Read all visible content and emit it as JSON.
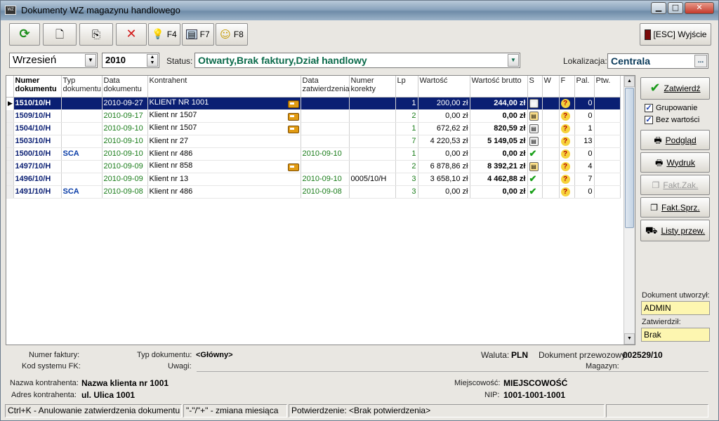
{
  "window": {
    "title": "Dokumenty WZ magazynu handlowego",
    "icon_label": "WZ"
  },
  "toolbar": {
    "f4_label": "F4",
    "f7_label": "F7",
    "f8_label": "F8",
    "exit_label": "[ESC] Wyjście"
  },
  "filters": {
    "month": "Wrzesień",
    "year": "2010",
    "status_label": "Status:",
    "status_value": "Otwarty,Brak faktury,Dział handlowy",
    "location_label": "Lokalizacja:",
    "location_value": "Centrala",
    "location_btn": "..."
  },
  "grid": {
    "headers": {
      "numer": "Numer dokumentu",
      "typ": "Typ dokumentu",
      "data": "Data dokumentu",
      "kontrahent": "Kontrahent",
      "data_zatw": "Data zatwierdzenia",
      "korekty": "Numer korekty",
      "lp": "Lp",
      "wartosc": "Wartość",
      "brutto": "Wartość brutto",
      "s": "S",
      "w": "W",
      "f": "F",
      "pal": "Pal.",
      "ptw": "Ptw."
    },
    "rows": [
      {
        "numer": "1510/10/H",
        "typ": "",
        "data": "2010-09-27",
        "kontrahent": "KLIENT NR 1001",
        "truck": true,
        "data_zatw": "",
        "korekta": "",
        "lp": "1",
        "wartosc": "200,00 zł",
        "brutto": "244,00 zł",
        "s": "doc",
        "f": "?",
        "pal": "0",
        "selected": true
      },
      {
        "numer": "1509/10/H",
        "typ": "",
        "data": "2010-09-17",
        "kontrahent": "Klient nr 1507",
        "truck": true,
        "data_zatw": "",
        "korekta": "",
        "lp": "2",
        "wartosc": "0,00 zł",
        "brutto": "0,00 zł",
        "s": "lock",
        "f": "?",
        "pal": "0"
      },
      {
        "numer": "1504/10/H",
        "typ": "",
        "data": "2010-09-10",
        "kontrahent": "Klient nr 1507",
        "truck": true,
        "data_zatw": "",
        "korekta": "",
        "lp": "1",
        "wartosc": "672,62 zł",
        "brutto": "820,59 zł",
        "s": "doc",
        "f": "?",
        "pal": "1"
      },
      {
        "numer": "1503/10/H",
        "typ": "",
        "data": "2010-09-10",
        "kontrahent": "Klient nr 27",
        "truck": false,
        "data_zatw": "",
        "korekta": "",
        "lp": "7",
        "wartosc": "4 220,53 zł",
        "brutto": "5 149,05 zł",
        "s": "doc",
        "f": "?",
        "pal": "13"
      },
      {
        "numer": "1500/10/H",
        "typ": "SCA",
        "data": "2010-09-10",
        "kontrahent": "Klient nr 486",
        "truck": false,
        "data_zatw": "2010-09-10",
        "korekta": "",
        "lp": "1",
        "wartosc": "0,00 zł",
        "brutto": "0,00 zł",
        "s": "check",
        "f": "?",
        "pal": "0"
      },
      {
        "numer": "1497/10/H",
        "typ": "",
        "data": "2010-09-09",
        "kontrahent": "Klient nr 858",
        "truck": true,
        "data_zatw": "",
        "korekta": "",
        "lp": "2",
        "wartosc": "6 878,86 zł",
        "brutto": "8 392,21 zł",
        "s": "lock",
        "f": "?",
        "pal": "4"
      },
      {
        "numer": "1496/10/H",
        "typ": "",
        "data": "2010-09-09",
        "kontrahent": "Klient nr 13",
        "truck": false,
        "data_zatw": "2010-09-10",
        "korekta": "0005/10/H",
        "lp": "3",
        "wartosc": "3 658,10 zł",
        "brutto": "4 462,88 zł",
        "s": "check",
        "f": "?",
        "pal": "7"
      },
      {
        "numer": "1491/10/H",
        "typ": "SCA",
        "data": "2010-09-08",
        "kontrahent": "Klient nr 486",
        "truck": false,
        "data_zatw": "2010-09-08",
        "korekta": "",
        "lp": "3",
        "wartosc": "0,00 zł",
        "brutto": "0,00 zł",
        "s": "check",
        "f": "?",
        "pal": "0"
      }
    ]
  },
  "side": {
    "zatwierdz": "Zatwierdź",
    "grupowanie": "Grupowanie",
    "bez_wartosci": "Bez wartości",
    "podglad": "Podgląd",
    "wydruk": "Wydruk",
    "fakt_zak": "Fakt.Zak.",
    "fakt_sprz": "Fakt.Sprz.",
    "listy": "Listy przew.",
    "utworzyl_label": "Dokument utworzył:",
    "utworzyl_value": "ADMIN",
    "zatwierdzil_label": "Zatwierdził:",
    "zatwierdzil_value": "Brak"
  },
  "details": {
    "numer_faktury_label": "Numer faktury:",
    "typ_label": "Typ dokumentu:",
    "typ_value": "<Główny>",
    "waluta_label": "Waluta:",
    "waluta_value": "PLN",
    "przewozowy_label": "Dokument przewozowy:",
    "przewozowy_value": "002529/10",
    "kod_label": "Kod systemu FK:",
    "uwagi_label": "Uwagi:",
    "magazyn_label": "Magazyn:",
    "nazwa_label": "Nazwa kontrahenta:",
    "nazwa_value": "Nazwa klienta nr 1001",
    "miejscowosc_label": "Miejscowość:",
    "miejscowosc_value": "MIEJSCOWOŚĆ",
    "adres_label": "Adres kontrahenta:",
    "adres_value": "ul. Ulica 1001",
    "nip_label": "NIP:",
    "nip_value": "1001-1001-1001"
  },
  "status": {
    "p1": "Ctrl+K - Anulowanie zatwierdzenia dokumentu",
    "p2": "\"-\"/\"+\" - zmiana miesiąca",
    "p3": "Potwierdzenie: <Brak potwierdzenia>"
  }
}
